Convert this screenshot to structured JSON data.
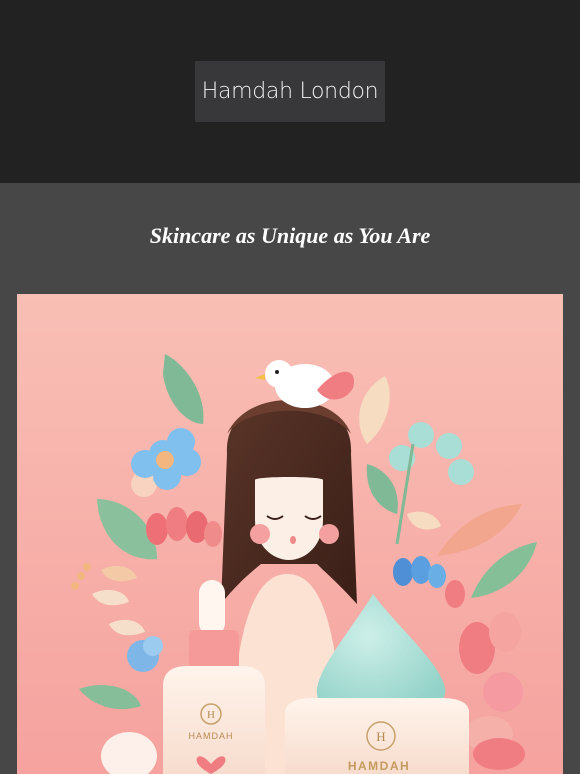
{
  "header": {
    "brand_name": "Hamdah London"
  },
  "main": {
    "headline": "Skincare as Unique as You Are"
  },
  "hero": {
    "bottle_label_top": "HAMDAH",
    "jar_label": "HAMDAH",
    "monogram": "H"
  },
  "colors": {
    "header_bg": "#222223",
    "body_bg": "#474747",
    "hero_bg": "#f8b0a8",
    "accent_pink": "#f29aa0",
    "accent_mint": "#a9ded6"
  }
}
